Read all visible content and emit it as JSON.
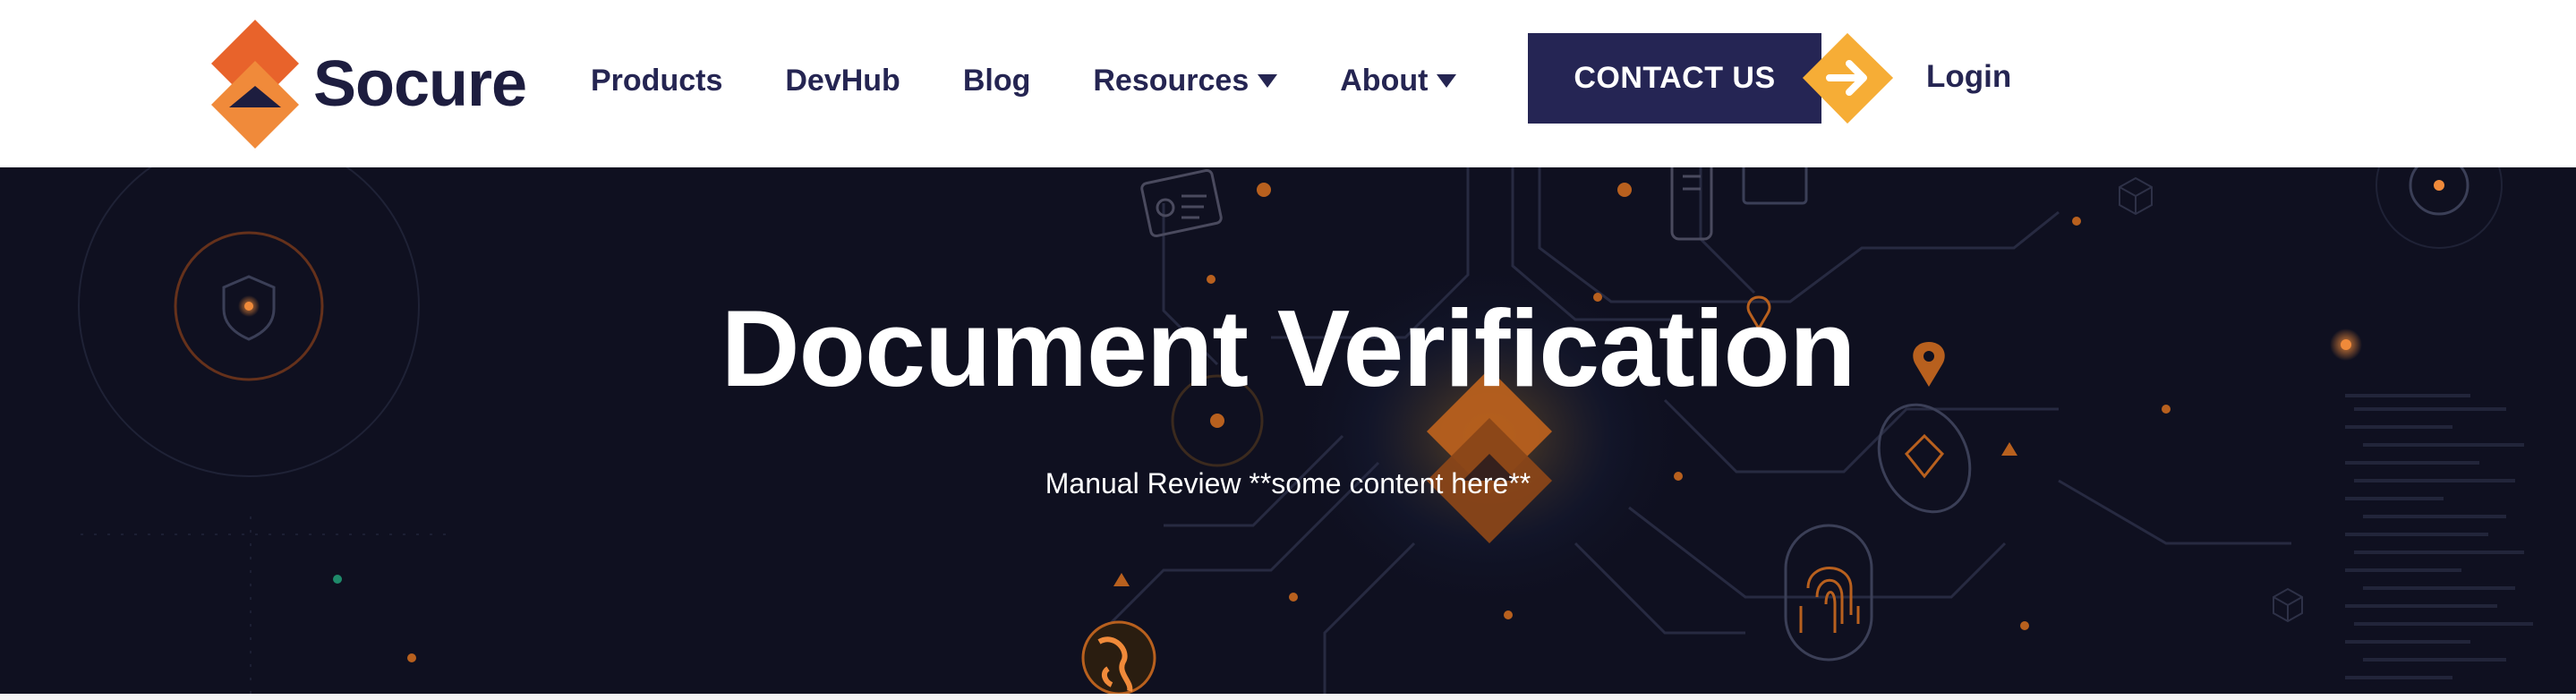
{
  "header": {
    "logo_text": "Socure",
    "nav": [
      {
        "label": "Products",
        "has_dropdown": false
      },
      {
        "label": "DevHub",
        "has_dropdown": false
      },
      {
        "label": "Blog",
        "has_dropdown": false
      },
      {
        "label": "Resources",
        "has_dropdown": true
      },
      {
        "label": "About",
        "has_dropdown": true
      }
    ],
    "contact_label": "CONTACT US",
    "login_label": "Login"
  },
  "hero": {
    "title": "Document Verification",
    "subtitle": "Manual Review **some content here**"
  },
  "icons": [
    "socure-logo-icon",
    "caret-down-icon",
    "arrow-right-icon",
    "shield-icon",
    "document-icon",
    "phone-icon",
    "location-pin-icon",
    "fingerprint-icon",
    "globe-icon",
    "warning-icon",
    "cube-icon"
  ],
  "colors": {
    "brand_navy": "#252554",
    "brand_orange": "#e8632b",
    "brand_orange_light": "#f08a3a",
    "arrow_yellow": "#f5a623",
    "hero_bg": "#0f1020"
  }
}
